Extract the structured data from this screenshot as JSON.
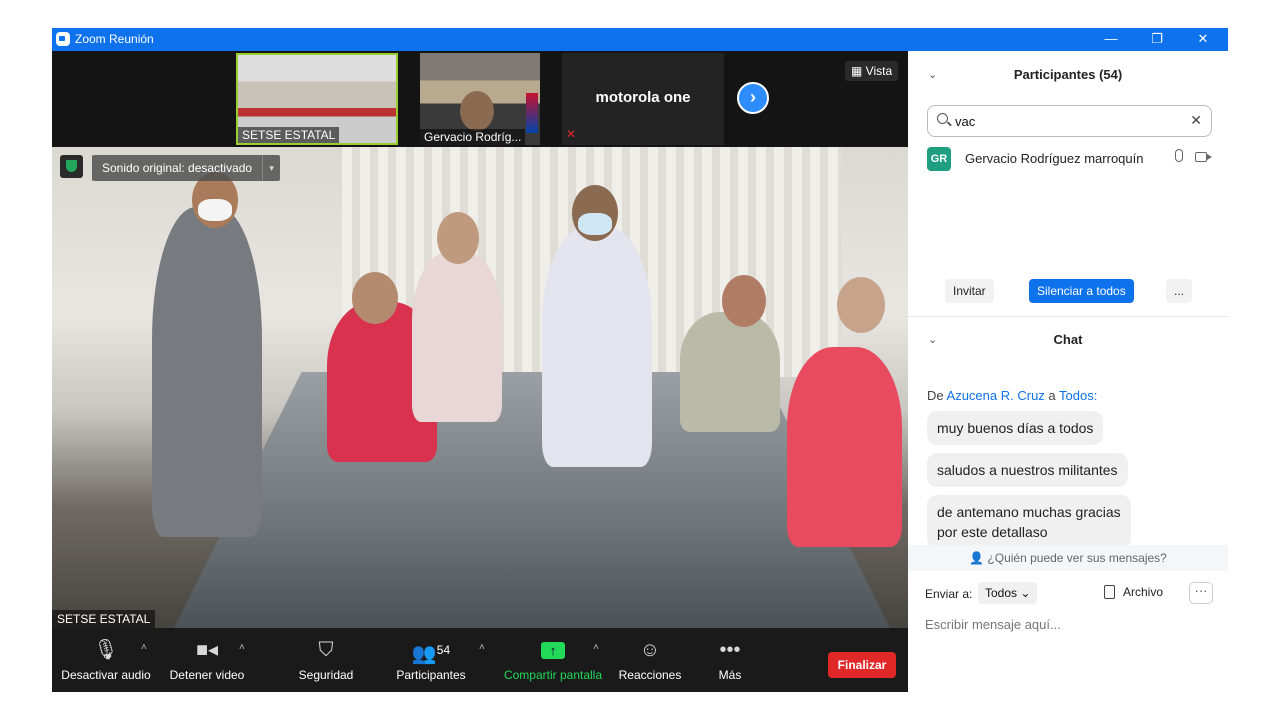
{
  "window": {
    "title": "Zoom Reunión",
    "minimize": "—",
    "restore": "❐",
    "close": "✕"
  },
  "strip": {
    "thumbs": [
      {
        "label": "SETSE ESTATAL"
      },
      {
        "label": "Gervacio Rodríg..."
      },
      {
        "name": "motorola one"
      }
    ],
    "next": "›",
    "view_label": "▦ Vista"
  },
  "main_video": {
    "sound_label": "Sonido original: desactivado",
    "sound_dropdown": "▾",
    "name_label": "SETSE ESTATAL"
  },
  "toolbar": {
    "audio": {
      "icon": "microphone-icon",
      "label": "Desactivar audio"
    },
    "video": {
      "icon": "video-camera-icon",
      "label": "Detener video"
    },
    "security": {
      "icon": "shield-icon",
      "label": "Seguridad"
    },
    "participants": {
      "icon": "participants-icon",
      "label": "Participantes",
      "count": "54"
    },
    "share": {
      "icon": "share-screen-icon",
      "label": "Compartir pantalla",
      "glyph": "↑"
    },
    "reactions": {
      "icon": "emoji-icon",
      "label": "Reacciones"
    },
    "more": {
      "icon": "more-icon",
      "label": "Más"
    },
    "caret": "˄",
    "end_label": "Finalizar"
  },
  "participants_panel": {
    "title": "Participantes (54)",
    "search_value": "vac",
    "clear": "✕",
    "participant": {
      "initials": "GR",
      "name": "Gervacio Rodríguez marroquín"
    },
    "buttons": {
      "invite": "Invitar",
      "mute_all": "Silenciar a todos",
      "more": "..."
    }
  },
  "chat_panel": {
    "title": "Chat",
    "from_prefix": "De",
    "from_sender": "Azucena R. Cruz",
    "from_mid": "a",
    "from_target": "Todos:",
    "messages": [
      "muy buenos días a todos",
      "saludos a nuestros militantes",
      "de antemano muchas gracias",
      "por este detallaso"
    ],
    "who_can_see": "¿Quién puede ver sus mensajes?",
    "send_to_label": "Enviar a:",
    "send_to_value": "Todos ⌄",
    "file_label": "Archivo",
    "more": "···",
    "input_placeholder": "Escribir mensaje aquí..."
  },
  "colors": {
    "zoom_blue": "#0e72ed",
    "share_green": "#23d959",
    "end_red": "#e02828",
    "avatar_green": "#1f9e82"
  }
}
